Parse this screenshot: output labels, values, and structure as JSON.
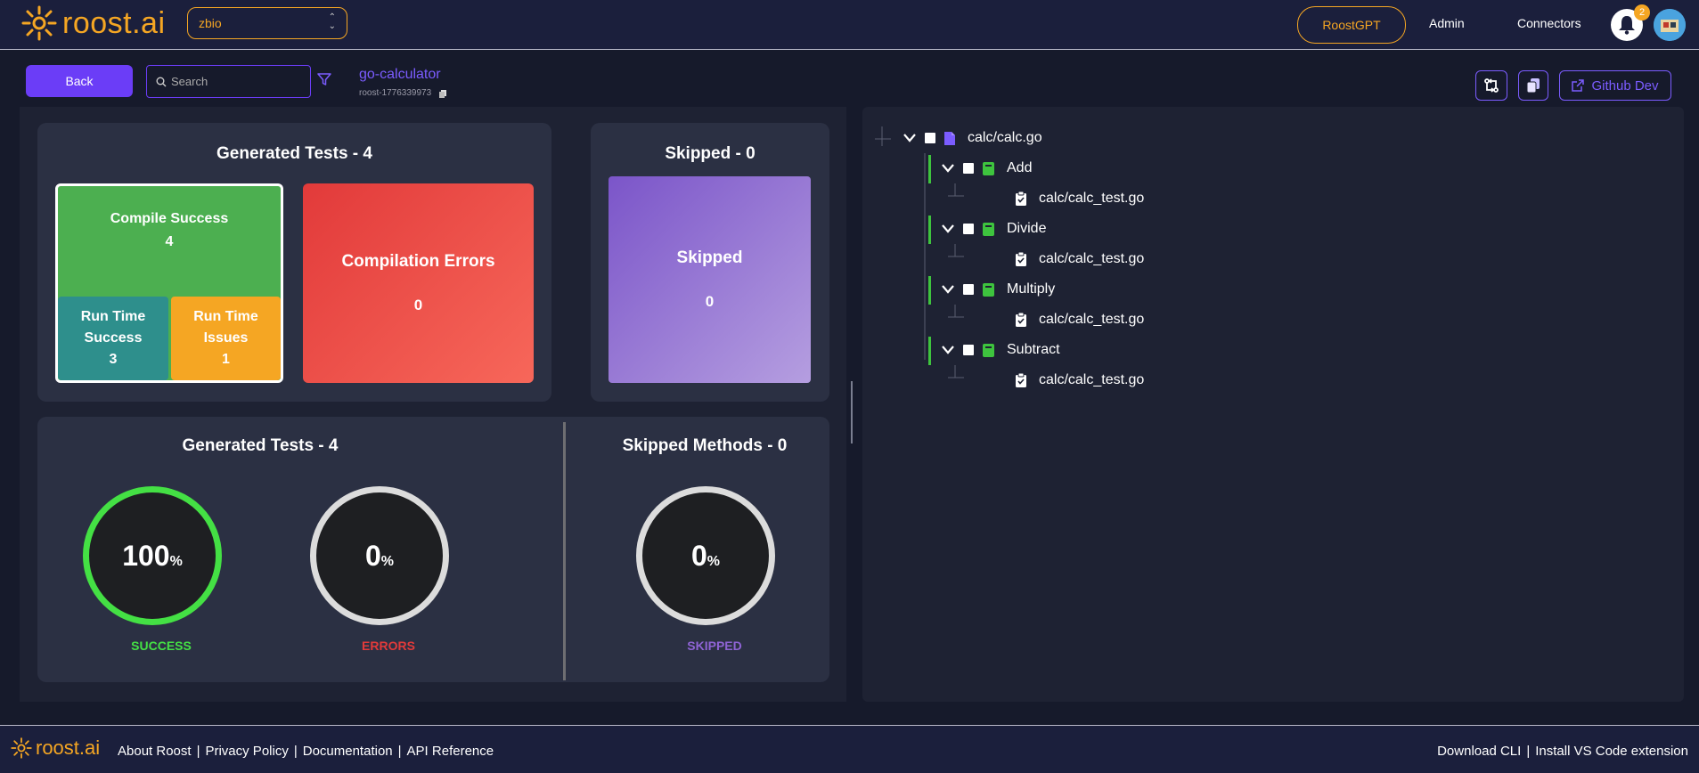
{
  "header": {
    "logo_text": "roost.ai",
    "org_select": "zbio",
    "roostgpt": "RoostGPT",
    "admin": "Admin",
    "connectors": "Connectors",
    "notification_count": "2"
  },
  "toolbar": {
    "back": "Back",
    "search_placeholder": "Search",
    "project_name": "go-calculator",
    "project_id": "roost-1776339973",
    "github_dev": "Github Dev"
  },
  "summary": {
    "generated_title": "Generated Tests - 4",
    "compile_success_label": "Compile Success",
    "compile_success_value": "4",
    "runtime_success_label": "Run Time Success",
    "runtime_success_value": "3",
    "runtime_issues_label": "Run Time Issues",
    "runtime_issues_value": "1",
    "compilation_errors_label": "Compilation Errors",
    "compilation_errors_value": "0",
    "skipped_title": "Skipped - 0",
    "skipped_label": "Skipped",
    "skipped_value": "0"
  },
  "rings": {
    "generated_title": "Generated Tests - 4",
    "skipped_title": "Skipped Methods - 0",
    "success_value": "100",
    "success_label": "SUCCESS",
    "errors_value": "0",
    "errors_label": "ERRORS",
    "skipped_value": "0",
    "skipped_label": "SKIPPED",
    "pct_symbol": "%"
  },
  "tree": {
    "root": "calc/calc.go",
    "methods": [
      {
        "name": "Add",
        "test": "calc/calc_test.go"
      },
      {
        "name": "Divide",
        "test": "calc/calc_test.go"
      },
      {
        "name": "Multiply",
        "test": "calc/calc_test.go"
      },
      {
        "name": "Subtract",
        "test": "calc/calc_test.go"
      }
    ]
  },
  "footer": {
    "logo_text": "roost.ai",
    "links": [
      "About Roost",
      "Privacy Policy",
      "Documentation",
      "API Reference"
    ],
    "right_links": [
      "Download CLI",
      "Install VS Code extension"
    ],
    "separator": "|"
  },
  "colors": {
    "accent": "#6b3df7",
    "brand": "#f5a623",
    "success": "#4caf50",
    "error": "#ef4444",
    "skipped": "#8e63d4"
  }
}
